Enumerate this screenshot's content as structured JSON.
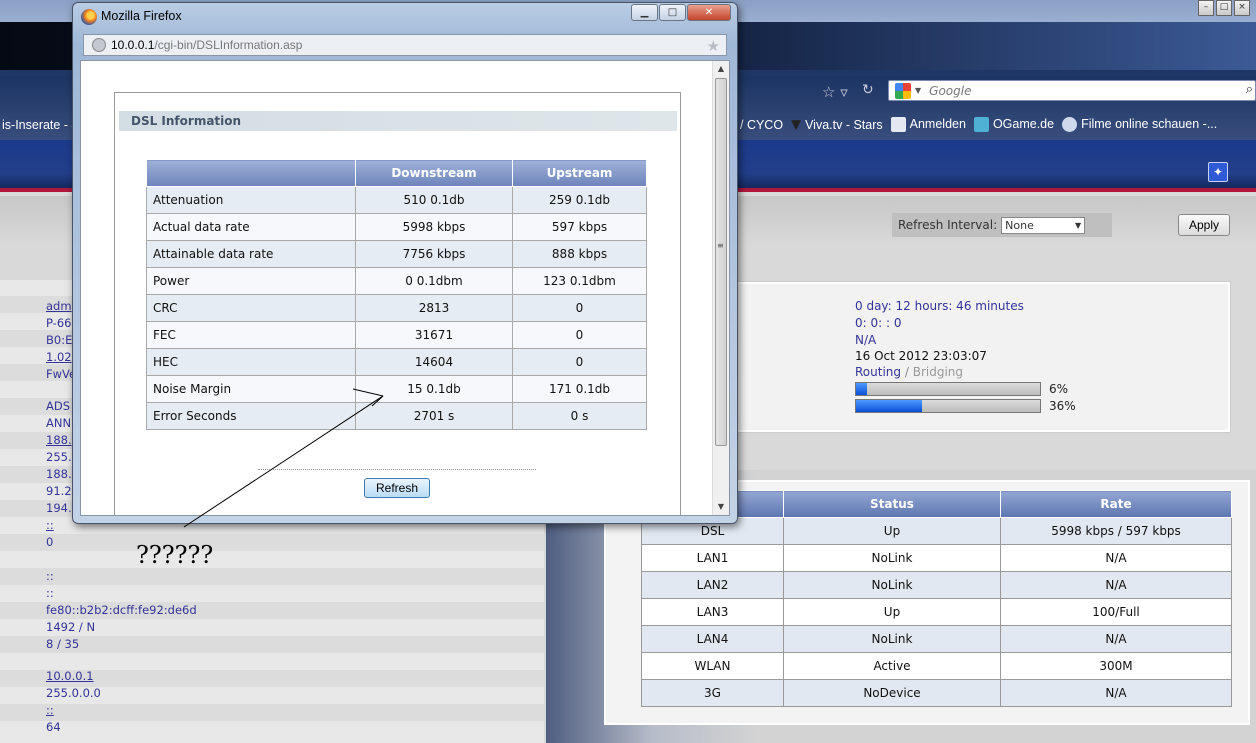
{
  "background": {
    "search_placeholder": "Google",
    "bookmarks_left": "is-Inserate - 4",
    "bookmarks": [
      "/ CYCO",
      "Viva.tv - Stars",
      "Anmelden",
      "OGame.de",
      "Filme online schauen -..."
    ],
    "refresh_interval_label": "Refresh Interval:",
    "refresh_interval_value": "None",
    "apply_label": "Apply",
    "left_values": [
      "adm",
      "P-66",
      "B0:E",
      "1.02",
      "FwVe",
      "ADS",
      "ANN",
      "188.",
      "255.",
      "188.",
      "91.2",
      "194.",
      "::",
      "0",
      "::",
      "::",
      "fe80::b2b2:dcff:fe92:de6d",
      "1492 / N",
      "8 / 35",
      "10.0.0.1",
      "255.0.0.0",
      "::",
      "64"
    ],
    "system": {
      "uptime": "0 day: 12 hours: 46 minutes",
      "ppp_uptime": "0: 0: : 0",
      "value_na": "N/A",
      "datetime": "16 Oct 2012 23:03:07",
      "mode_routing": "Routing",
      "mode_sep": "/",
      "mode_bridging": "Bridging",
      "cpu_percent": 6,
      "cpu_label": "6%",
      "mem_percent": 36,
      "mem_label": "36%"
    },
    "port_table": {
      "headers": [
        "",
        "Status",
        "Rate"
      ],
      "rows": [
        [
          "DSL",
          "Up",
          "5998 kbps / 597 kbps"
        ],
        [
          "LAN1",
          "NoLink",
          "N/A"
        ],
        [
          "LAN2",
          "NoLink",
          "N/A"
        ],
        [
          "LAN3",
          "Up",
          "100/Full"
        ],
        [
          "LAN4",
          "NoLink",
          "N/A"
        ],
        [
          "WLAN",
          "Active",
          "300M"
        ],
        [
          "3G",
          "NoDevice",
          "N/A"
        ]
      ]
    }
  },
  "popup": {
    "title": "Mozilla Firefox",
    "url_host": "10.0.0.1",
    "url_path": "/cgi-bin/DSLInformation.asp",
    "section_title": "DSL Information",
    "columns": [
      "",
      "Downstream",
      "Upstream"
    ],
    "rows": [
      [
        "Attenuation",
        "510 0.1db",
        "259 0.1db"
      ],
      [
        "Actual data rate",
        "5998 kbps",
        "597 kbps"
      ],
      [
        "Attainable data rate",
        "7756 kbps",
        "888 kbps"
      ],
      [
        "Power",
        "0 0.1dbm",
        "123 0.1dbm"
      ],
      [
        "CRC",
        "2813",
        "0"
      ],
      [
        "FEC",
        "31671",
        "0"
      ],
      [
        "HEC",
        "14604",
        "0"
      ],
      [
        "Noise Margin",
        "15 0.1db",
        "171 0.1db"
      ],
      [
        "Error Seconds",
        "2701 s",
        "0 s"
      ]
    ],
    "refresh_label": "Refresh"
  },
  "annotation": "??????",
  "colors": {
    "accent": "#1b3a8c",
    "stripe": "#b0173c",
    "link": "#333399"
  }
}
